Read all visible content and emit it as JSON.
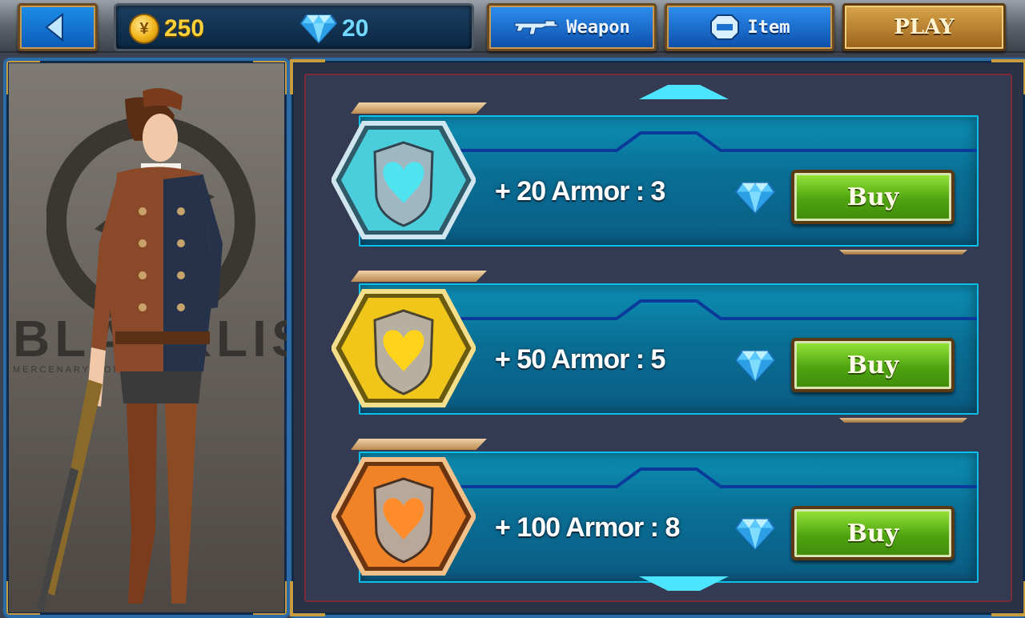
{
  "topbar": {
    "coins": "250",
    "coin_symbol": "¥",
    "gems": "20",
    "tabs": {
      "weapon": "Weapon",
      "item": "Item"
    },
    "play": "PLAY"
  },
  "character_panel": {
    "brand": "BLACKLIST",
    "subtitle": "MERCENARY CORPORATION"
  },
  "shop": {
    "items": [
      {
        "label": "+ 20 Armor :  3",
        "color": "#4fe3ef",
        "buy": "Buy"
      },
      {
        "label": "+ 50 Armor :  5",
        "color": "#ffd21c",
        "buy": "Buy"
      },
      {
        "label": "+ 100 Armor :  8",
        "color": "#ff8c2a",
        "buy": "Buy"
      }
    ]
  },
  "icons": [
    "back-arrow-icon",
    "coin-icon",
    "diamond-icon",
    "rifle-icon",
    "item-box-icon",
    "shield-heart-icon",
    "scroll-up-icon",
    "scroll-down-icon"
  ]
}
